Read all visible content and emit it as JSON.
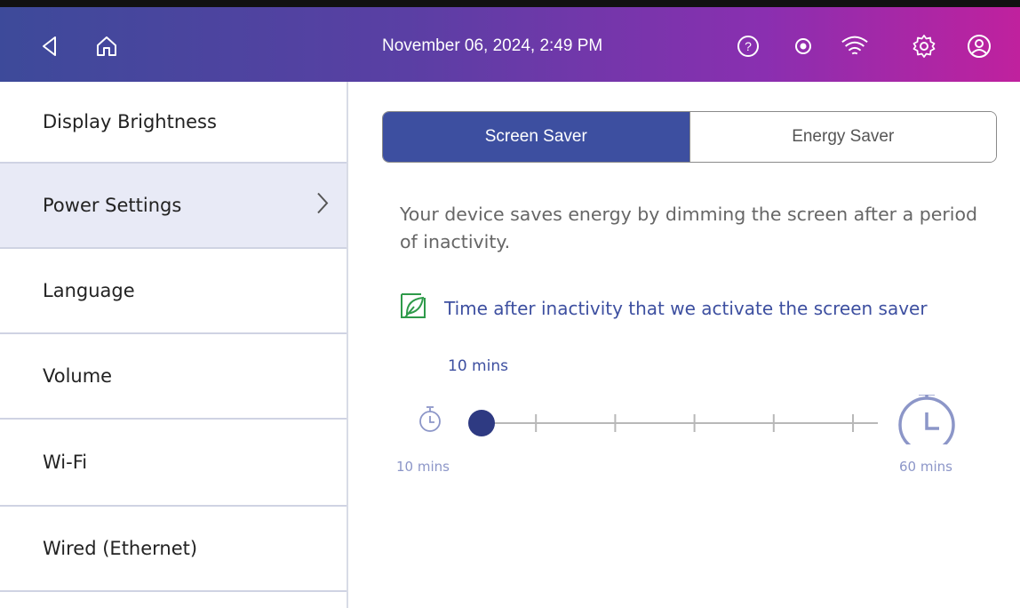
{
  "header": {
    "datetime": "November 06, 2024, 2:49 PM",
    "icons": [
      "back-icon",
      "home-icon",
      "help-icon",
      "record-icon",
      "wifi-icon",
      "gear-icon",
      "user-icon"
    ]
  },
  "sidebar": {
    "items": [
      {
        "label": "Display Brightness",
        "active": false
      },
      {
        "label": "Power Settings",
        "active": true
      },
      {
        "label": "Language",
        "active": false
      },
      {
        "label": "Volume",
        "active": false
      },
      {
        "label": "Wi-Fi",
        "active": false
      },
      {
        "label": "Wired (Ethernet)",
        "active": false
      }
    ]
  },
  "main": {
    "tabs": [
      {
        "label": "Screen Saver",
        "selected": true
      },
      {
        "label": "Energy Saver",
        "selected": false
      }
    ],
    "description": "Your device saves energy by dimming the screen after a period of inactivity.",
    "hint": "Time after inactivity that we activate the screen saver",
    "slider": {
      "current_label": "10 mins",
      "min_label": "10  mins",
      "max_label": "60  mins",
      "value_fraction": 0.0,
      "ticks": 6
    }
  },
  "colors": {
    "accent": "#3d4fa0",
    "active_bg": "#e8eaf6",
    "leaf": "#2e9a4a",
    "slider_light": "#8c96c8"
  }
}
